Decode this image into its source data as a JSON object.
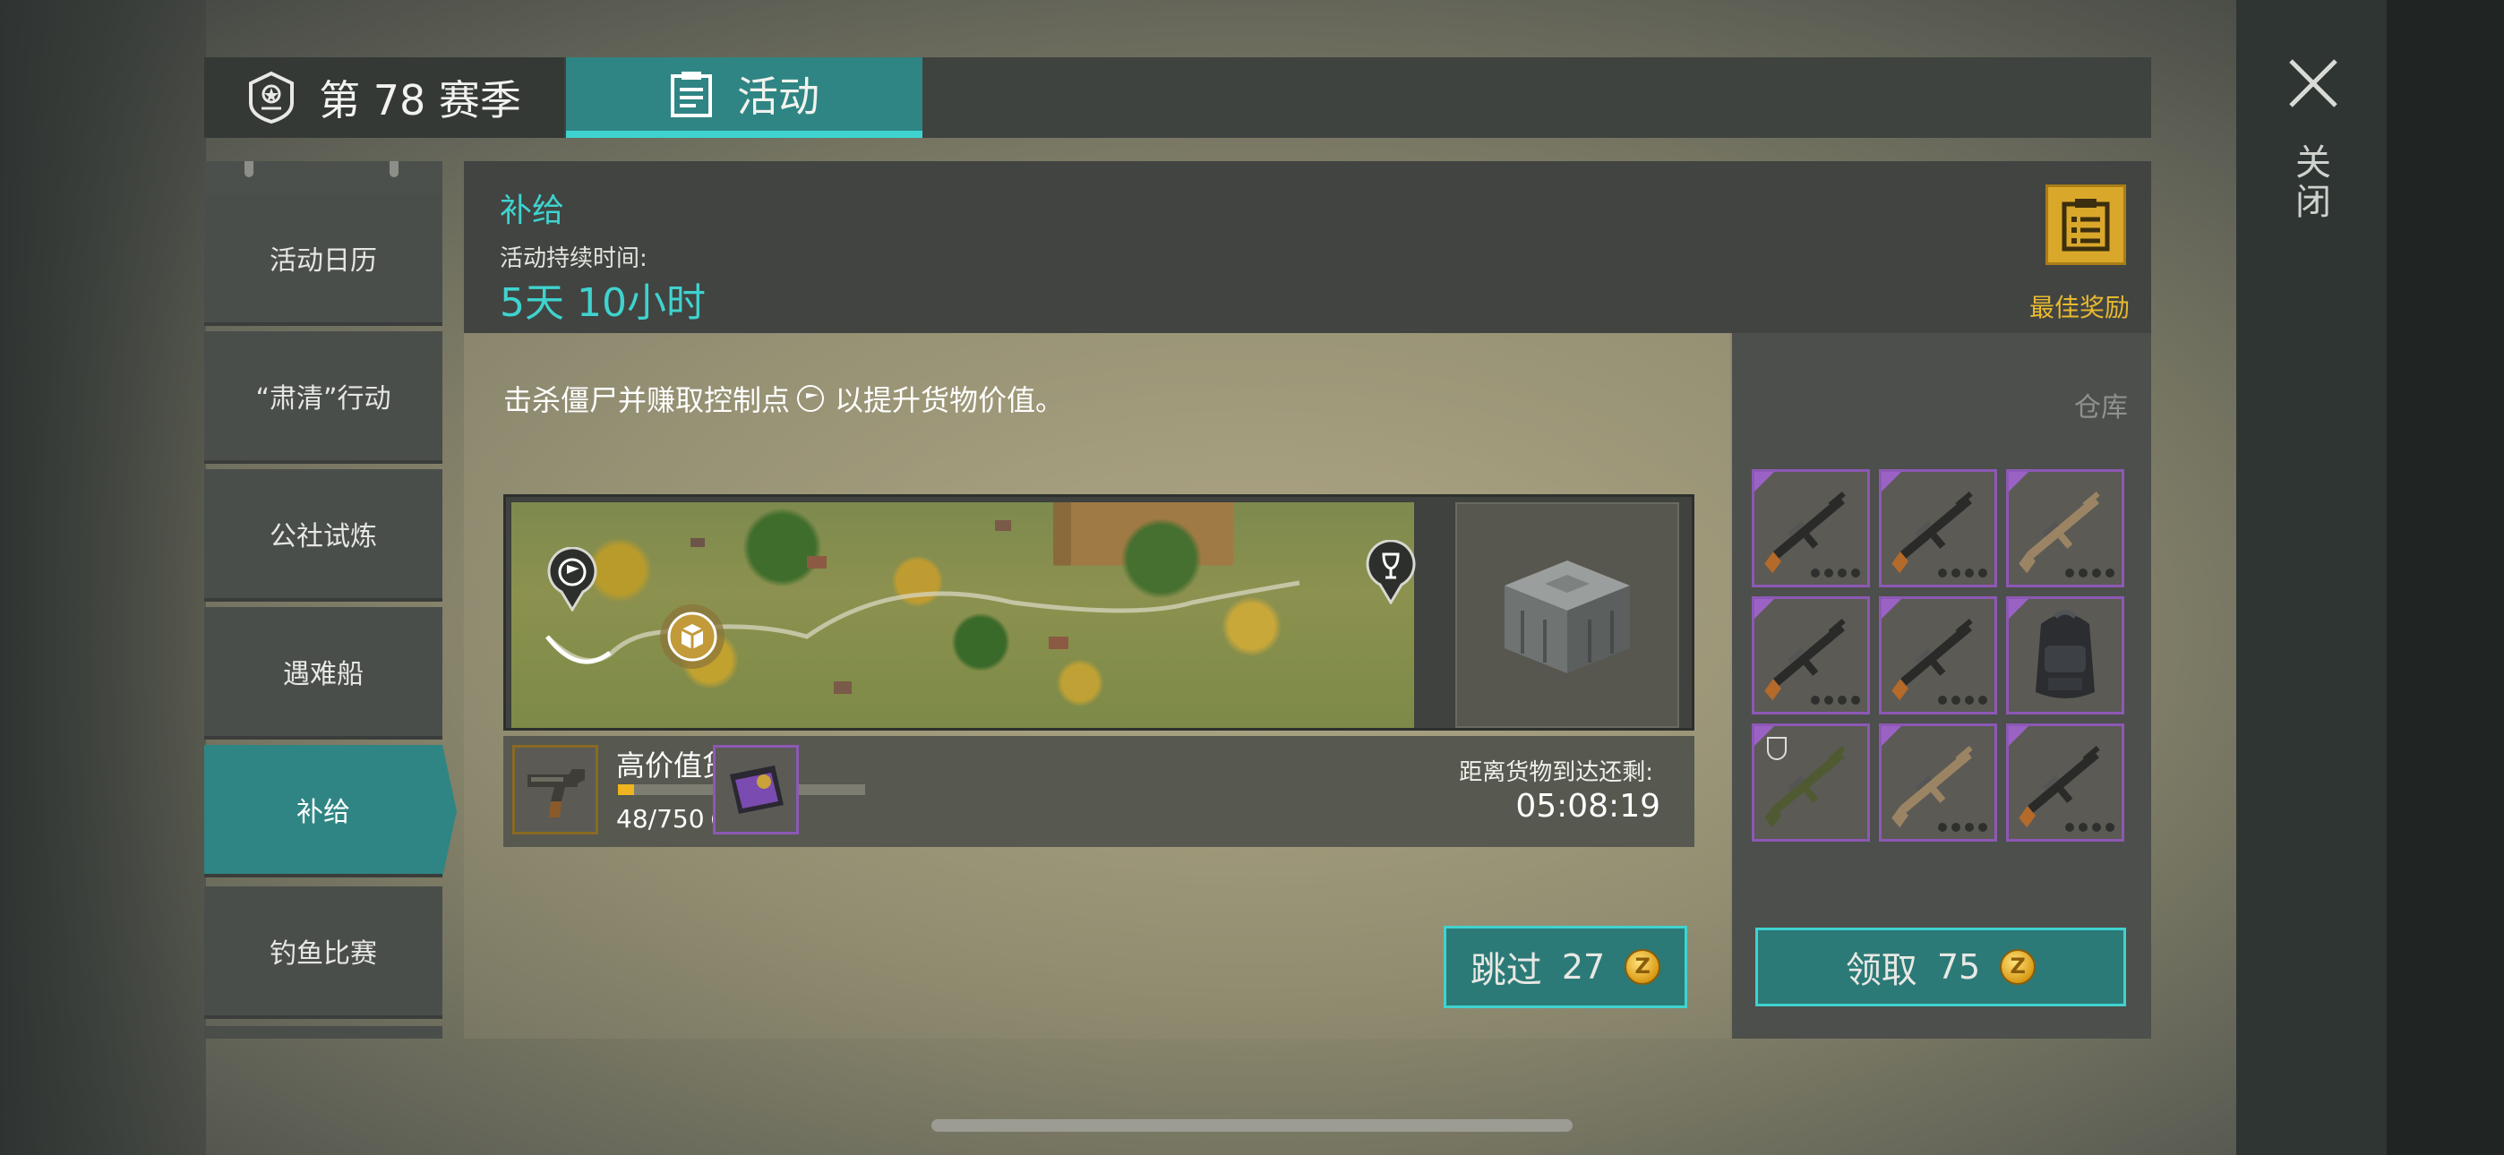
{
  "tabs": {
    "season": "第 78 赛季",
    "activity": "活动"
  },
  "sidebar": {
    "items": [
      {
        "label": "活动日历"
      },
      {
        "label": "“肃清”行动"
      },
      {
        "label": "公社试炼"
      },
      {
        "label": "遇难船"
      },
      {
        "label": "补给",
        "active": true
      },
      {
        "label": "钓鱼比赛"
      }
    ]
  },
  "header": {
    "title": "补给",
    "duration_label": "活动持续时间:",
    "duration_value": "5天 10小时",
    "best_reward_label": "最佳奖励"
  },
  "content": {
    "description_pre": "击杀僵尸并赚取控制点",
    "description_post": "以提升货物价值。",
    "cargo_title": "高价值货物",
    "cargo_count": "48/750",
    "cargo_progress": 0.064,
    "eta_label": "距离货物到达还剩:",
    "eta_time": "05:08:19",
    "skip_label": "跳过",
    "skip_cost": "27"
  },
  "warehouse": {
    "label": "仓库",
    "claim_label": "领取",
    "claim_cost": "75",
    "items": [
      {
        "kind": "rifle-dark"
      },
      {
        "kind": "rifle-dark"
      },
      {
        "kind": "rifle-tan"
      },
      {
        "kind": "rifle-dark"
      },
      {
        "kind": "rifle-dark"
      },
      {
        "kind": "backpack"
      },
      {
        "kind": "rifle-green"
      },
      {
        "kind": "rifle-tan"
      },
      {
        "kind": "rifle-dark"
      }
    ]
  },
  "close_label": "关闭",
  "colors": {
    "accent_teal": "#3fd3cf",
    "teal_bg": "#2f8583",
    "gold": "#e8b930",
    "rarity_purple": "#8d58b5"
  }
}
